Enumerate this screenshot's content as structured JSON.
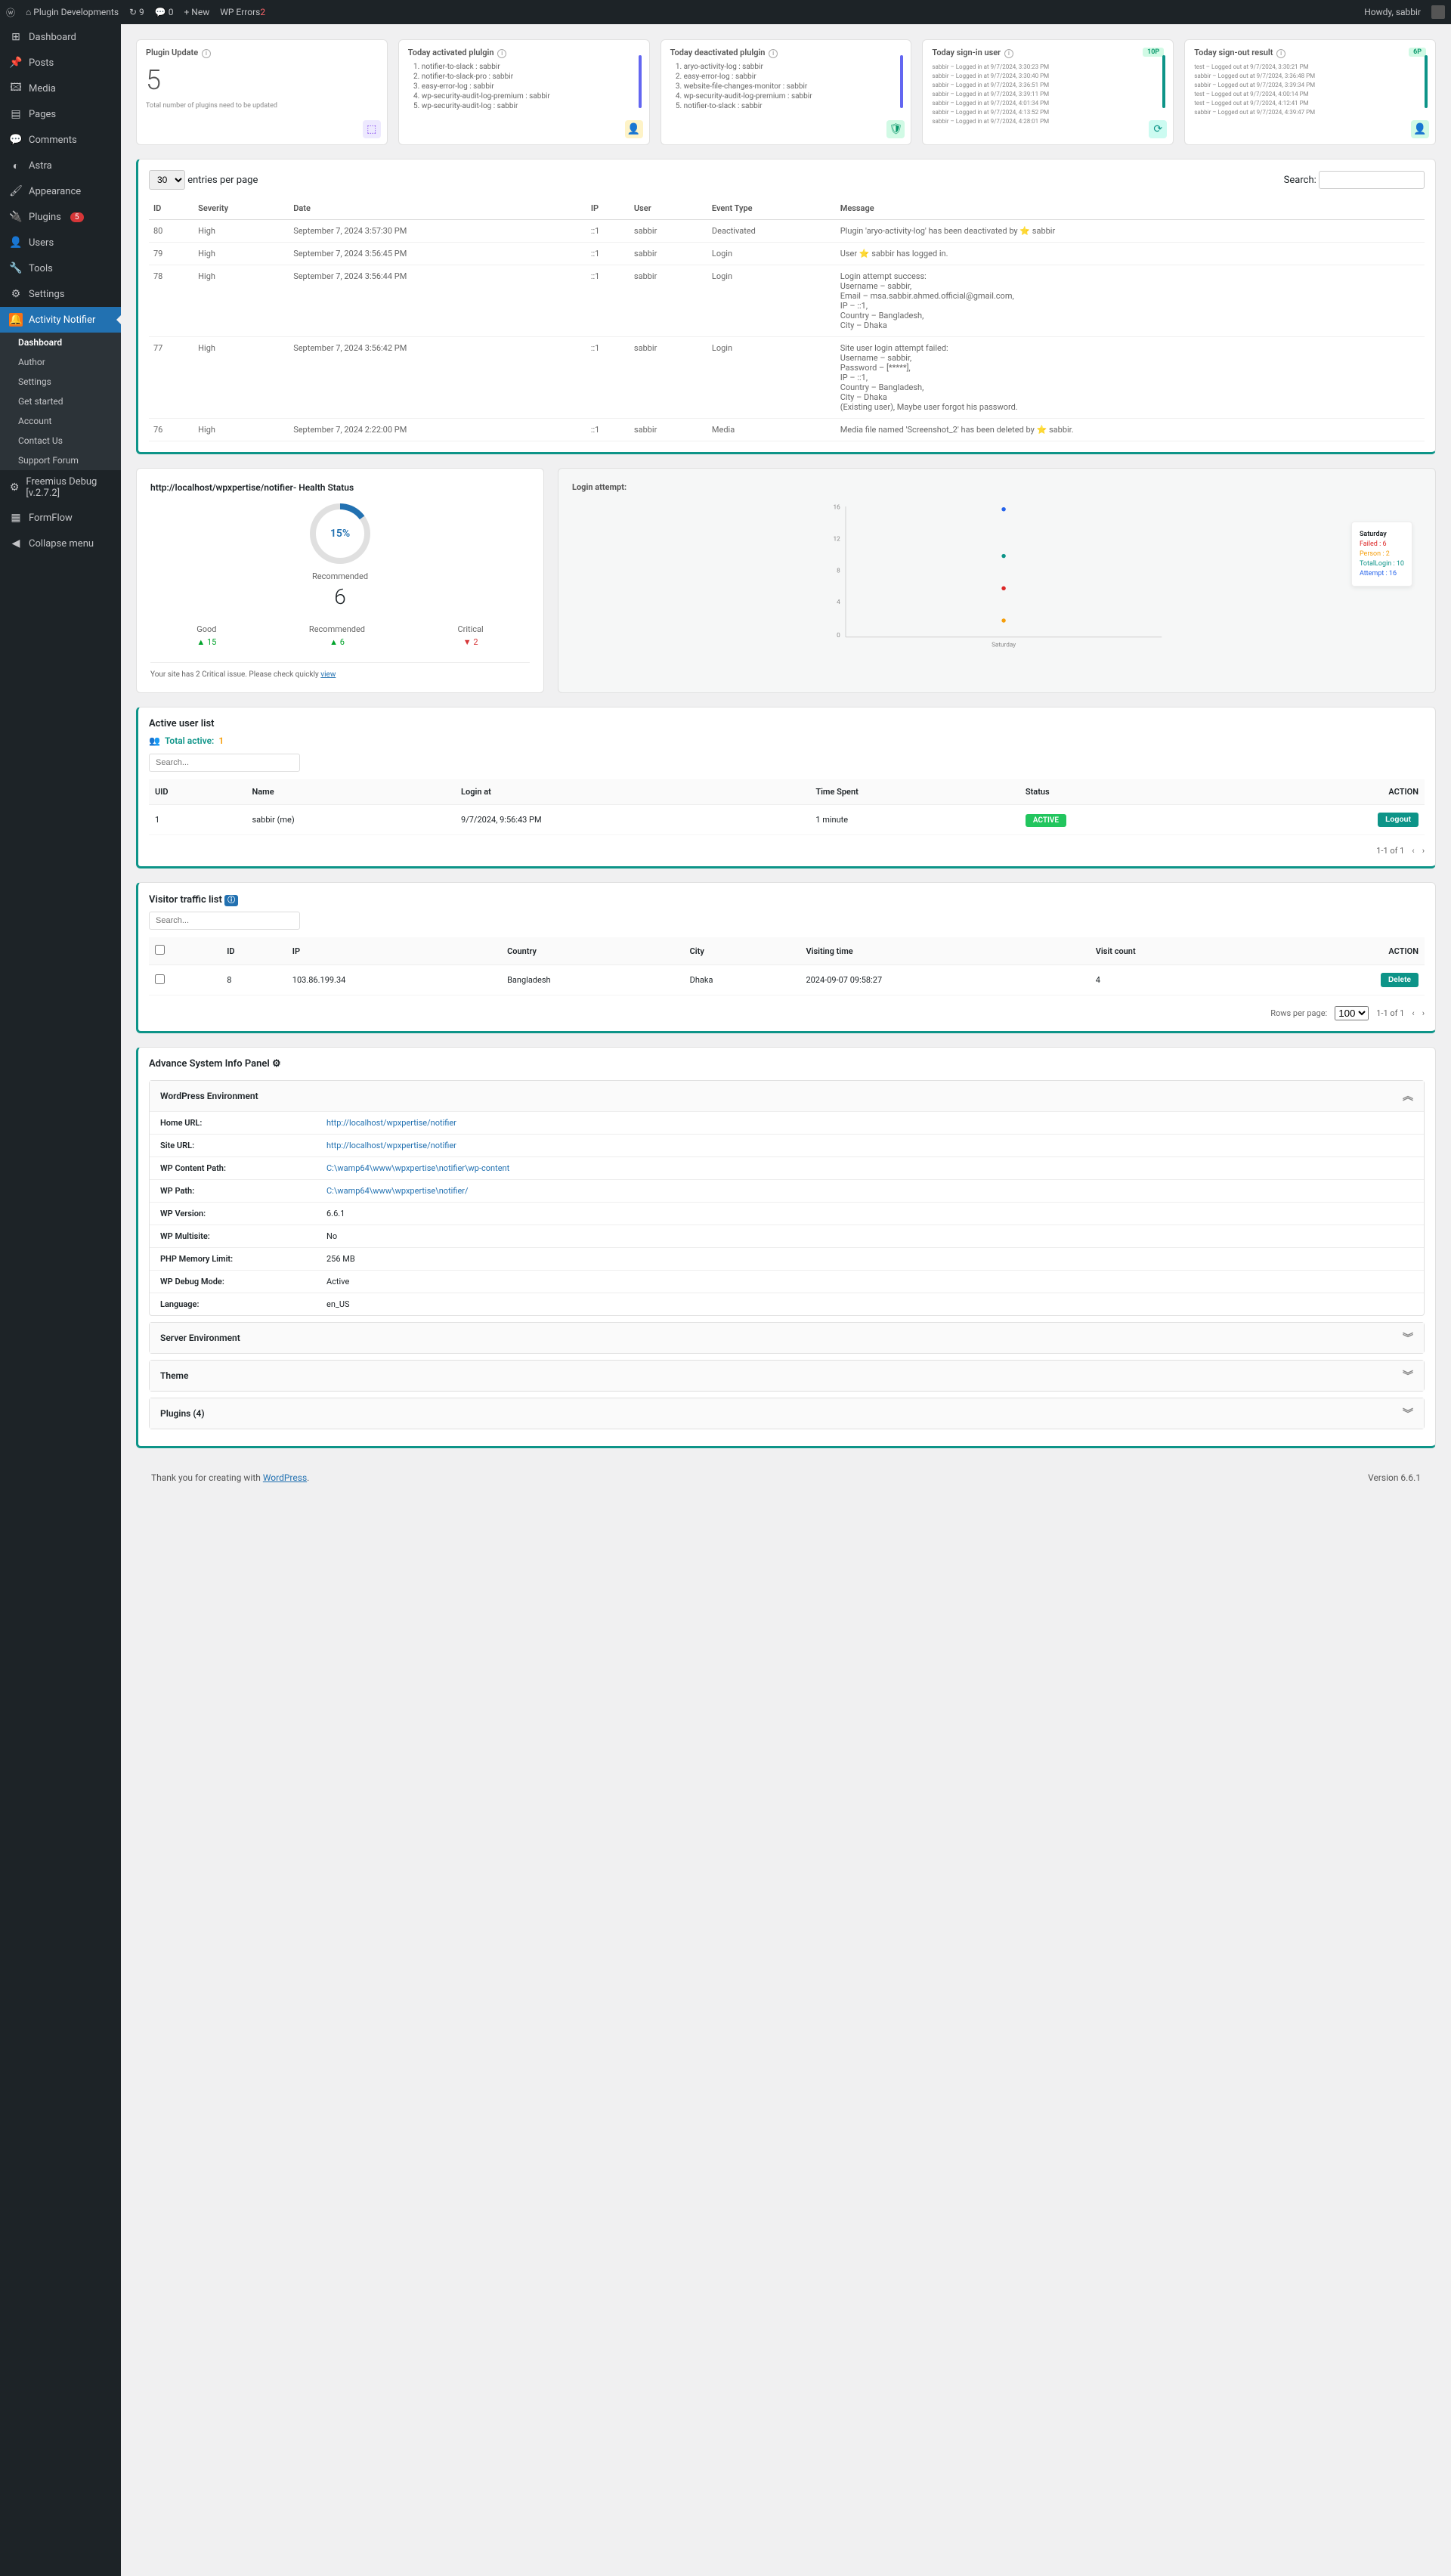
{
  "adminbar": {
    "site": "Plugin Developments",
    "refresh": "9",
    "comments": "0",
    "new": "New",
    "wpe": "WP Errors",
    "wpecount": "2",
    "howdy": "Howdy, sabbir"
  },
  "sidebar": {
    "items": [
      "Dashboard",
      "Posts",
      "Media",
      "Pages",
      "Comments",
      "Astra",
      "Appearance",
      "Plugins",
      "Users",
      "Tools",
      "Settings",
      "Activity Notifier"
    ],
    "plugins_badge": "5",
    "sub": [
      "Dashboard",
      "Author",
      "Settings",
      "Get started",
      "Account",
      "Contact Us",
      "Support Forum"
    ],
    "freemius": "Freemius Debug [v.2.7.2]",
    "formflow": "FormFlow",
    "collapse": "Collapse menu"
  },
  "cards": {
    "update": {
      "title": "Plugin Update",
      "count": "5",
      "note": "Total number of plugins need to be updated"
    },
    "activated": {
      "title": "Today activated plulgin",
      "items": [
        "notifier-to-slack : sabbir",
        "notifier-to-slack-pro : sabbir",
        "easy-error-log : sabbir",
        "wp-security-audit-log-premium : sabbir",
        "wp-security-audit-log : sabbir"
      ]
    },
    "deactivated": {
      "title": "Today deactivated plulgin",
      "items": [
        "aryo-activity-log : sabbir",
        "easy-error-log : sabbir",
        "website-file-changes-monitor : sabbir",
        "wp-security-audit-log-premium : sabbir",
        "notifier-to-slack : sabbir"
      ]
    },
    "signin": {
      "title": "Today sign-in user",
      "pill": "10P",
      "items": [
        "sabbir – Logged in at 9/7/2024, 3:30:23 PM",
        "sabbir – Logged in at 9/7/2024, 3:30:40 PM",
        "sabbir – Logged in at 9/7/2024, 3:36:51 PM",
        "sabbir – Logged in at 9/7/2024, 3:39:11 PM",
        "sabbir – Logged in at 9/7/2024, 4:01:34 PM",
        "sabbir – Logged in at 9/7/2024, 4:13:52 PM",
        "sabbir – Logged in at 9/7/2024, 4:28:01 PM"
      ]
    },
    "signout": {
      "title": "Today sign-out result",
      "pill": "6P",
      "items": [
        "test – Logged out at 9/7/2024, 3:30:21 PM",
        "sabbir – Logged out at 9/7/2024, 3:36:48 PM",
        "sabbir – Logged out at 9/7/2024, 3:39:34 PM",
        "test – Logged out at 9/7/2024, 4:00:14 PM",
        "test – Logged out at 9/7/2024, 4:12:41 PM",
        "sabbir – Logged out at 9/7/2024, 4:39:47 PM"
      ]
    }
  },
  "logtable": {
    "entries_label": "entries per page",
    "entries_value": "30",
    "search": "Search:",
    "cols": [
      "ID",
      "Severity",
      "Date",
      "IP",
      "User",
      "Event Type",
      "Message"
    ],
    "rows": [
      {
        "id": "80",
        "sev": "High",
        "date": "September 7, 2024 3:57:30 PM",
        "ip": "::1",
        "user": "sabbir",
        "evt": "Deactivated",
        "msg": "Plugin 'aryo-activity-log' has been deactivated by ⭐ sabbir"
      },
      {
        "id": "79",
        "sev": "High",
        "date": "September 7, 2024 3:56:45 PM",
        "ip": "::1",
        "user": "sabbir",
        "evt": "Login",
        "msg": "User ⭐ sabbir has logged in."
      },
      {
        "id": "78",
        "sev": "High",
        "date": "September 7, 2024 3:56:44 PM",
        "ip": "::1",
        "user": "sabbir",
        "evt": "Login",
        "msg": "Login attempt success:\nUsername – sabbir,\nEmail – msa.sabbir.ahmed.official@gmail.com,\nIP – ::1,\nCountry – Bangladesh,\nCity – Dhaka"
      },
      {
        "id": "77",
        "sev": "High",
        "date": "September 7, 2024 3:56:42 PM",
        "ip": "::1",
        "user": "sabbir",
        "evt": "Login",
        "msg": "Site user login attempt failed:\nUsername – sabbir,\nPassword – [*****],\nIP – ::1,\nCountry – Bangladesh,\nCity – Dhaka\n(Existing user), Maybe user forgot his password."
      },
      {
        "id": "76",
        "sev": "High",
        "date": "September 7, 2024 2:22:00 PM",
        "ip": "::1",
        "user": "sabbir",
        "evt": "Media",
        "msg": "Media file named 'Screenshot_2' has been deleted by ⭐ sabbir."
      }
    ]
  },
  "health": {
    "title": "http://localhost/wpxpertise/notifier- Health Status",
    "pct": "15%",
    "reclabel": "Recommended",
    "recnum": "6",
    "good": "Good",
    "goodv": "15",
    "rec": "Recommended",
    "recv": "6",
    "crit": "Critical",
    "critv": "2",
    "note": "Your site has 2 Critical issue. Please check quickly ",
    "link": "view"
  },
  "chart_data": {
    "type": "scatter",
    "title": "Login attempt:",
    "xlabel": "Saturday",
    "ylabel": "",
    "ylim": [
      0,
      16
    ],
    "categories": [
      "Saturday"
    ],
    "series": [
      {
        "name": "Failed",
        "color": "#dc2626",
        "values": [
          6
        ]
      },
      {
        "name": "Person",
        "color": "#f59e0b",
        "values": [
          2
        ]
      },
      {
        "name": "TotalLogin",
        "color": "#0d9488",
        "values": [
          10
        ]
      },
      {
        "name": "Attempt",
        "color": "#2563eb",
        "values": [
          16
        ]
      }
    ],
    "legend": {
      "title": "Saturday",
      "items": [
        "Failed : 6",
        "Person : 2",
        "TotalLogin : 10",
        "Attempt : 16"
      ]
    }
  },
  "activeusers": {
    "title": "Active user list",
    "total_label": "Total active:",
    "total": "1",
    "search_ph": "Search...",
    "cols": [
      "UID",
      "Name",
      "Login at",
      "Time Spent",
      "Status",
      "ACTION"
    ],
    "rows": [
      {
        "uid": "1",
        "name": "sabbir (me)",
        "login": "9/7/2024, 9:56:43 PM",
        "time": "1 minute",
        "status": "ACTIVE",
        "action": "Logout"
      }
    ],
    "pagin": "1-1 of 1"
  },
  "visitors": {
    "title": "Visitor traffic list",
    "search_ph": "Search...",
    "cols": [
      "ID",
      "IP",
      "Country",
      "City",
      "Visiting time",
      "Visit count",
      "ACTION"
    ],
    "rows": [
      {
        "id": "8",
        "ip": "103.86.199.34",
        "country": "Bangladesh",
        "city": "Dhaka",
        "time": "2024-09-07 09:58:27",
        "count": "4",
        "action": "Delete"
      }
    ],
    "rpp_label": "Rows per page:",
    "rpp": "100",
    "pagin": "1-1 of 1"
  },
  "sysinfo": {
    "title": "Advance System Info Panel",
    "wpenv": {
      "title": "WordPress Environment",
      "rows": [
        [
          "Home URL:",
          "http://localhost/wpxpertise/notifier"
        ],
        [
          "Site URL:",
          "http://localhost/wpxpertise/notifier"
        ],
        [
          "WP Content Path:",
          "C:\\wamp64\\www\\wpxpertise\\notifier\\wp-content"
        ],
        [
          "WP Path:",
          "C:\\wamp64\\www\\wpxpertise\\notifier/"
        ],
        [
          "WP Version:",
          "6.6.1"
        ],
        [
          "WP Multisite:",
          "No"
        ],
        [
          "PHP Memory Limit:",
          "256 MB"
        ],
        [
          "WP Debug Mode:",
          "Active"
        ],
        [
          "Language:",
          "en_US"
        ]
      ]
    },
    "server": "Server Environment",
    "theme": "Theme",
    "plugins": "Plugins (4)"
  },
  "footer": {
    "thank": "Thank you for creating with ",
    "wp": "WordPress",
    "ver": "Version 6.6.1"
  }
}
